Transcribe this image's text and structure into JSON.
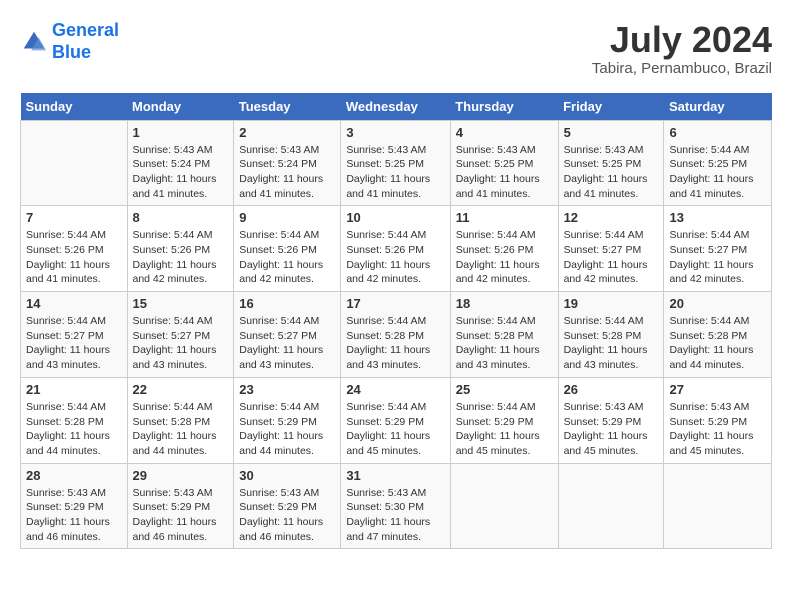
{
  "header": {
    "logo_line1": "General",
    "logo_line2": "Blue",
    "month_title": "July 2024",
    "location": "Tabira, Pernambuco, Brazil"
  },
  "days_of_week": [
    "Sunday",
    "Monday",
    "Tuesday",
    "Wednesday",
    "Thursday",
    "Friday",
    "Saturday"
  ],
  "weeks": [
    [
      {
        "day": "",
        "info": ""
      },
      {
        "day": "1",
        "info": "Sunrise: 5:43 AM\nSunset: 5:24 PM\nDaylight: 11 hours and 41 minutes."
      },
      {
        "day": "2",
        "info": "Sunrise: 5:43 AM\nSunset: 5:24 PM\nDaylight: 11 hours and 41 minutes."
      },
      {
        "day": "3",
        "info": "Sunrise: 5:43 AM\nSunset: 5:25 PM\nDaylight: 11 hours and 41 minutes."
      },
      {
        "day": "4",
        "info": "Sunrise: 5:43 AM\nSunset: 5:25 PM\nDaylight: 11 hours and 41 minutes."
      },
      {
        "day": "5",
        "info": "Sunrise: 5:43 AM\nSunset: 5:25 PM\nDaylight: 11 hours and 41 minutes."
      },
      {
        "day": "6",
        "info": "Sunrise: 5:44 AM\nSunset: 5:25 PM\nDaylight: 11 hours and 41 minutes."
      }
    ],
    [
      {
        "day": "7",
        "info": "Sunrise: 5:44 AM\nSunset: 5:26 PM\nDaylight: 11 hours and 41 minutes."
      },
      {
        "day": "8",
        "info": "Sunrise: 5:44 AM\nSunset: 5:26 PM\nDaylight: 11 hours and 42 minutes."
      },
      {
        "day": "9",
        "info": "Sunrise: 5:44 AM\nSunset: 5:26 PM\nDaylight: 11 hours and 42 minutes."
      },
      {
        "day": "10",
        "info": "Sunrise: 5:44 AM\nSunset: 5:26 PM\nDaylight: 11 hours and 42 minutes."
      },
      {
        "day": "11",
        "info": "Sunrise: 5:44 AM\nSunset: 5:26 PM\nDaylight: 11 hours and 42 minutes."
      },
      {
        "day": "12",
        "info": "Sunrise: 5:44 AM\nSunset: 5:27 PM\nDaylight: 11 hours and 42 minutes."
      },
      {
        "day": "13",
        "info": "Sunrise: 5:44 AM\nSunset: 5:27 PM\nDaylight: 11 hours and 42 minutes."
      }
    ],
    [
      {
        "day": "14",
        "info": "Sunrise: 5:44 AM\nSunset: 5:27 PM\nDaylight: 11 hours and 43 minutes."
      },
      {
        "day": "15",
        "info": "Sunrise: 5:44 AM\nSunset: 5:27 PM\nDaylight: 11 hours and 43 minutes."
      },
      {
        "day": "16",
        "info": "Sunrise: 5:44 AM\nSunset: 5:27 PM\nDaylight: 11 hours and 43 minutes."
      },
      {
        "day": "17",
        "info": "Sunrise: 5:44 AM\nSunset: 5:28 PM\nDaylight: 11 hours and 43 minutes."
      },
      {
        "day": "18",
        "info": "Sunrise: 5:44 AM\nSunset: 5:28 PM\nDaylight: 11 hours and 43 minutes."
      },
      {
        "day": "19",
        "info": "Sunrise: 5:44 AM\nSunset: 5:28 PM\nDaylight: 11 hours and 43 minutes."
      },
      {
        "day": "20",
        "info": "Sunrise: 5:44 AM\nSunset: 5:28 PM\nDaylight: 11 hours and 44 minutes."
      }
    ],
    [
      {
        "day": "21",
        "info": "Sunrise: 5:44 AM\nSunset: 5:28 PM\nDaylight: 11 hours and 44 minutes."
      },
      {
        "day": "22",
        "info": "Sunrise: 5:44 AM\nSunset: 5:28 PM\nDaylight: 11 hours and 44 minutes."
      },
      {
        "day": "23",
        "info": "Sunrise: 5:44 AM\nSunset: 5:29 PM\nDaylight: 11 hours and 44 minutes."
      },
      {
        "day": "24",
        "info": "Sunrise: 5:44 AM\nSunset: 5:29 PM\nDaylight: 11 hours and 45 minutes."
      },
      {
        "day": "25",
        "info": "Sunrise: 5:44 AM\nSunset: 5:29 PM\nDaylight: 11 hours and 45 minutes."
      },
      {
        "day": "26",
        "info": "Sunrise: 5:43 AM\nSunset: 5:29 PM\nDaylight: 11 hours and 45 minutes."
      },
      {
        "day": "27",
        "info": "Sunrise: 5:43 AM\nSunset: 5:29 PM\nDaylight: 11 hours and 45 minutes."
      }
    ],
    [
      {
        "day": "28",
        "info": "Sunrise: 5:43 AM\nSunset: 5:29 PM\nDaylight: 11 hours and 46 minutes."
      },
      {
        "day": "29",
        "info": "Sunrise: 5:43 AM\nSunset: 5:29 PM\nDaylight: 11 hours and 46 minutes."
      },
      {
        "day": "30",
        "info": "Sunrise: 5:43 AM\nSunset: 5:29 PM\nDaylight: 11 hours and 46 minutes."
      },
      {
        "day": "31",
        "info": "Sunrise: 5:43 AM\nSunset: 5:30 PM\nDaylight: 11 hours and 47 minutes."
      },
      {
        "day": "",
        "info": ""
      },
      {
        "day": "",
        "info": ""
      },
      {
        "day": "",
        "info": ""
      }
    ]
  ]
}
